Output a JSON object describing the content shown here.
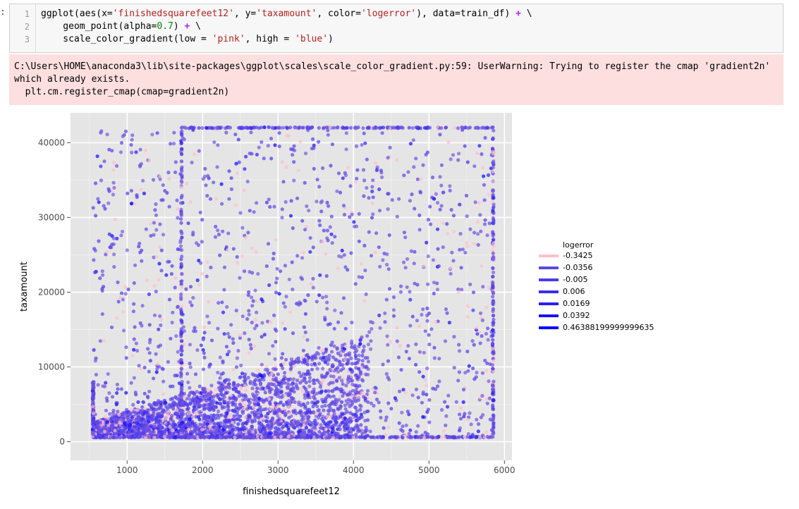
{
  "prompt_marker": ":",
  "code_cell": {
    "lines": [
      {
        "num": "1"
      },
      {
        "num": "2"
      },
      {
        "num": "3"
      }
    ]
  },
  "stderr": {
    "text": "C:\\Users\\HOME\\anaconda3\\lib\\site-packages\\ggplot\\scales\\scale_color_gradient.py:59: UserWarning: Trying to register the cmap 'gradient2n' which already exists.\n  plt.cm.register_cmap(cmap=gradient2n)"
  },
  "chart_data": {
    "type": "scatter",
    "title": "",
    "xlabel": "finishedsquarefeet12",
    "ylabel": "taxamount",
    "xlim": [
      250,
      6100
    ],
    "ylim": [
      -2500,
      44000
    ],
    "xticks": [
      1000,
      2000,
      3000,
      4000,
      5000,
      6000
    ],
    "xtick_labels": [
      "1000",
      "2000",
      "3000",
      "4000",
      "5000",
      "6000"
    ],
    "yticks": [
      0,
      10000,
      20000,
      30000,
      40000
    ],
    "ytick_labels": [
      "0",
      "10000",
      "20000",
      "30000",
      "40000"
    ],
    "grid": true,
    "background": "#e5e5e5",
    "color_low": "#ffc0cb",
    "color_high": "#0000ff",
    "point_alpha": 0.7,
    "legend": {
      "title": "logerror",
      "placement": "right",
      "entries": [
        {
          "label": "-0.3425",
          "color": "#ffc0cb"
        },
        {
          "label": "-0.0356",
          "color": "#5a48e0"
        },
        {
          "label": "-0.005",
          "color": "#4a3ae8"
        },
        {
          "label": "0.006",
          "color": "#3a2cee"
        },
        {
          "label": "0.0169",
          "color": "#2a1ef2"
        },
        {
          "label": "0.0392",
          "color": "#1a10f6"
        },
        {
          "label": "0.46388199999999635",
          "color": "#0000ff"
        }
      ]
    },
    "point_clusters": [
      {
        "desc": "dense core",
        "x_range": [
          550,
          4200
        ],
        "y_range": [
          600,
          15000
        ],
        "n": 2600
      },
      {
        "desc": "spread",
        "x_range": [
          550,
          5850
        ],
        "y_range": [
          600,
          42000
        ],
        "n": 1300
      },
      {
        "desc": "cap line top",
        "x_range": [
          1720,
          5850
        ],
        "y_value": 42000,
        "n": 180
      },
      {
        "desc": "cap line right",
        "x_value": 5850,
        "y_range": [
          600,
          42000
        ],
        "n": 160
      },
      {
        "desc": "cap line left",
        "x_value": 1720,
        "y_range": [
          600,
          42000
        ],
        "n": 120
      },
      {
        "desc": "floor line",
        "x_range": [
          550,
          5850
        ],
        "y_value": 600,
        "n": 400
      },
      {
        "desc": "left edge",
        "x_value": 550,
        "y_range": [
          600,
          8000
        ],
        "n": 120
      }
    ]
  }
}
